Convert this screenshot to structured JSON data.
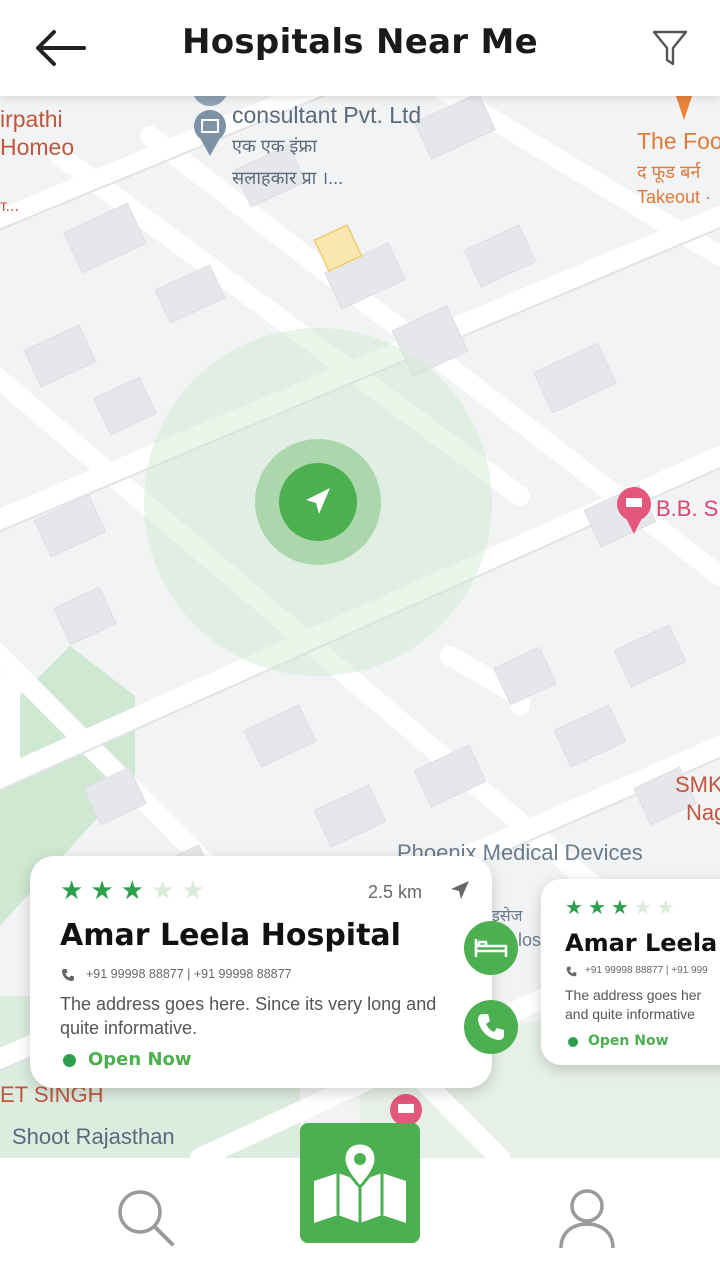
{
  "header": {
    "title": "Hospitals Near Me"
  },
  "map_labels": {
    "consultant_en": "consultant Pvt. Ltd",
    "consultant_hi_1": "एक एक इंफ्रा",
    "consultant_hi_2": "सलाहकार प्रा ।...",
    "tirupathi": "irpathi",
    "homeo": "Homeo",
    "ellipsis": "т...",
    "food_en": "The Foo",
    "food_hi": "द फूड बर्न",
    "takeout": "Takeout ·",
    "bbs": "B.B. S",
    "smk": "SMK",
    "nag": "Nag",
    "phoenix": "Phoenix Medical Devices",
    "eesej": "इसेज",
    "dos": "los",
    "singh": "ET SINGH",
    "shoot": "Shoot Rajasthan"
  },
  "cards": [
    {
      "rating": 3,
      "max_rating": 5,
      "distance": "2.5 km",
      "name": "Amar Leela Hospital",
      "phones": "+91 99998 88877 | +91 99998 88877",
      "address": "The address goes here. Since its very long and quite informative.",
      "status": "Open Now"
    },
    {
      "rating": 3,
      "max_rating": 5,
      "name": "Amar Leela H",
      "phones": "+91 99998 88877 | +91 999",
      "address_line1": "The address goes her",
      "address_line2": "and quite informative",
      "status": "Open Now"
    }
  ],
  "colors": {
    "accent": "#4caf50",
    "star": "#2e9e4f",
    "map_bg": "#f2f3f4",
    "road": "#ffffff",
    "park": "#cfe8d2",
    "poi_orange": "#e8833a",
    "poi_pink": "#e4567a"
  },
  "icons": {
    "back": "arrow-left-icon",
    "filter": "filter-icon",
    "location": "navigation-arrow-icon",
    "bed": "bed-icon",
    "phone": "phone-icon",
    "map": "map-icon",
    "search": "search-icon",
    "profile": "user-icon"
  }
}
